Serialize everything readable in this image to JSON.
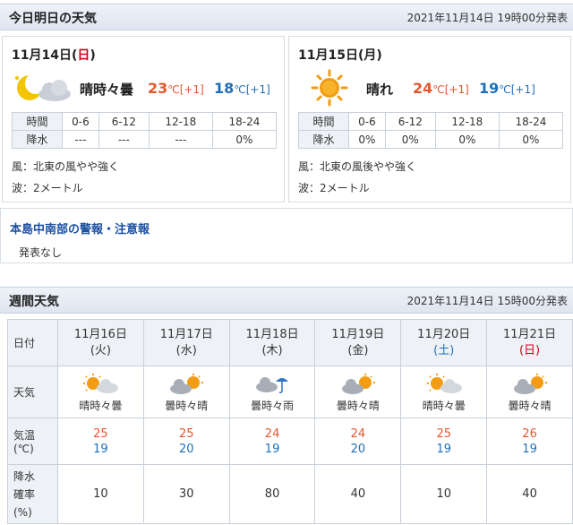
{
  "today": {
    "title": "今日明日の天気",
    "issued": "2021年11月14日 19時00分発表",
    "prob_label_time": "時間",
    "prob_label_rain": "降水",
    "days": [
      {
        "date": "11月14日",
        "dow_open": "(",
        "dow": "日",
        "dow_close": ")",
        "weather": "晴時々曇",
        "icon": "moon-cloud-icon",
        "high": "23",
        "high_diff": "[+1]",
        "low": "18",
        "low_diff": "[+1]",
        "unit": "℃",
        "times": [
          "0-6",
          "6-12",
          "12-18",
          "18-24"
        ],
        "rain": [
          "---",
          "---",
          "---",
          "0%"
        ],
        "wind": "風：北東の風やや強く",
        "wave": "波：2メートル"
      },
      {
        "date": "11月15日",
        "dow_open": "(",
        "dow": "月",
        "dow_close": ")",
        "weather": "晴れ",
        "icon": "sun-icon",
        "high": "24",
        "high_diff": "[+1]",
        "low": "19",
        "low_diff": "[+1]",
        "unit": "℃",
        "times": [
          "0-6",
          "6-12",
          "12-18",
          "18-24"
        ],
        "rain": [
          "0%",
          "0%",
          "0%",
          "0%"
        ],
        "wind": "風：北東の風後やや強く",
        "wave": "波：2メートル"
      }
    ]
  },
  "warning": {
    "title": "本島中南部の警報・注意報",
    "body": "発表なし"
  },
  "weekly": {
    "title": "週間天気",
    "issued": "2021年11月14日 15時00分発表",
    "row_labels": {
      "date": "日付",
      "weather": "天気",
      "temp_line1": "気温",
      "temp_line2": "(℃)",
      "rain_line1": "降水",
      "rain_line2": "確率",
      "rain_line3": "(%)"
    },
    "days": [
      {
        "date": "11月16日",
        "dow": "(火)",
        "weather": "晴時々曇",
        "icon": "sun-cloud-icon",
        "high": "25",
        "low": "19",
        "rain": "10",
        "dow_color": "#333333"
      },
      {
        "date": "11月17日",
        "dow": "(水)",
        "weather": "曇時々晴",
        "icon": "cloud-sun-icon",
        "high": "25",
        "low": "20",
        "rain": "30",
        "dow_color": "#333333"
      },
      {
        "date": "11月18日",
        "dow": "(木)",
        "weather": "曇時々雨",
        "icon": "cloud-rain-icon",
        "high": "24",
        "low": "19",
        "rain": "80",
        "dow_color": "#333333"
      },
      {
        "date": "11月19日",
        "dow": "(金)",
        "weather": "曇時々晴",
        "icon": "cloud-sun-icon",
        "high": "24",
        "low": "20",
        "rain": "40",
        "dow_color": "#333333"
      },
      {
        "date": "11月20日",
        "dow": "(土)",
        "weather": "晴時々曇",
        "icon": "sun-cloud-icon",
        "high": "25",
        "low": "19",
        "rain": "10",
        "dow_color": "#1f6fb8"
      },
      {
        "date": "11月21日",
        "dow": "(日)",
        "weather": "曇時々晴",
        "icon": "cloud-sun-icon",
        "high": "26",
        "low": "19",
        "rain": "40",
        "dow_color": "#d0021b"
      }
    ]
  },
  "colors": {
    "high": "#e4572e",
    "low": "#1f6fb8",
    "sunday": "#d0021b",
    "saturday": "#1f6fb8",
    "link": "#1a4fa0",
    "header_bg": "#dfe6f0"
  }
}
